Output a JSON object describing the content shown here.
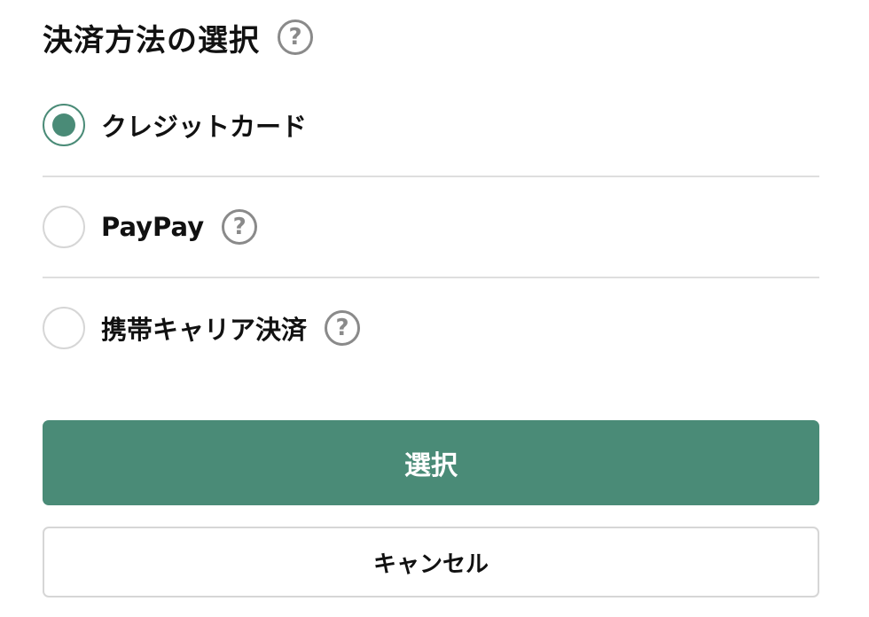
{
  "header": {
    "title": "決済方法の選択",
    "help_glyph": "?",
    "help_icon": "question-circle-icon"
  },
  "payment_options": [
    {
      "label": "クレジットカード",
      "selected": true,
      "has_help": false
    },
    {
      "label": "PayPay",
      "selected": false,
      "has_help": true,
      "help_glyph": "?"
    },
    {
      "label": "携帯キャリア決済",
      "selected": false,
      "has_help": true,
      "help_glyph": "?"
    }
  ],
  "actions": {
    "submit_label": "選択",
    "cancel_label": "キャンセル"
  },
  "colors": {
    "accent": "#4a8b77",
    "help_icon": "#8a8a8a",
    "border": "#dedede"
  }
}
